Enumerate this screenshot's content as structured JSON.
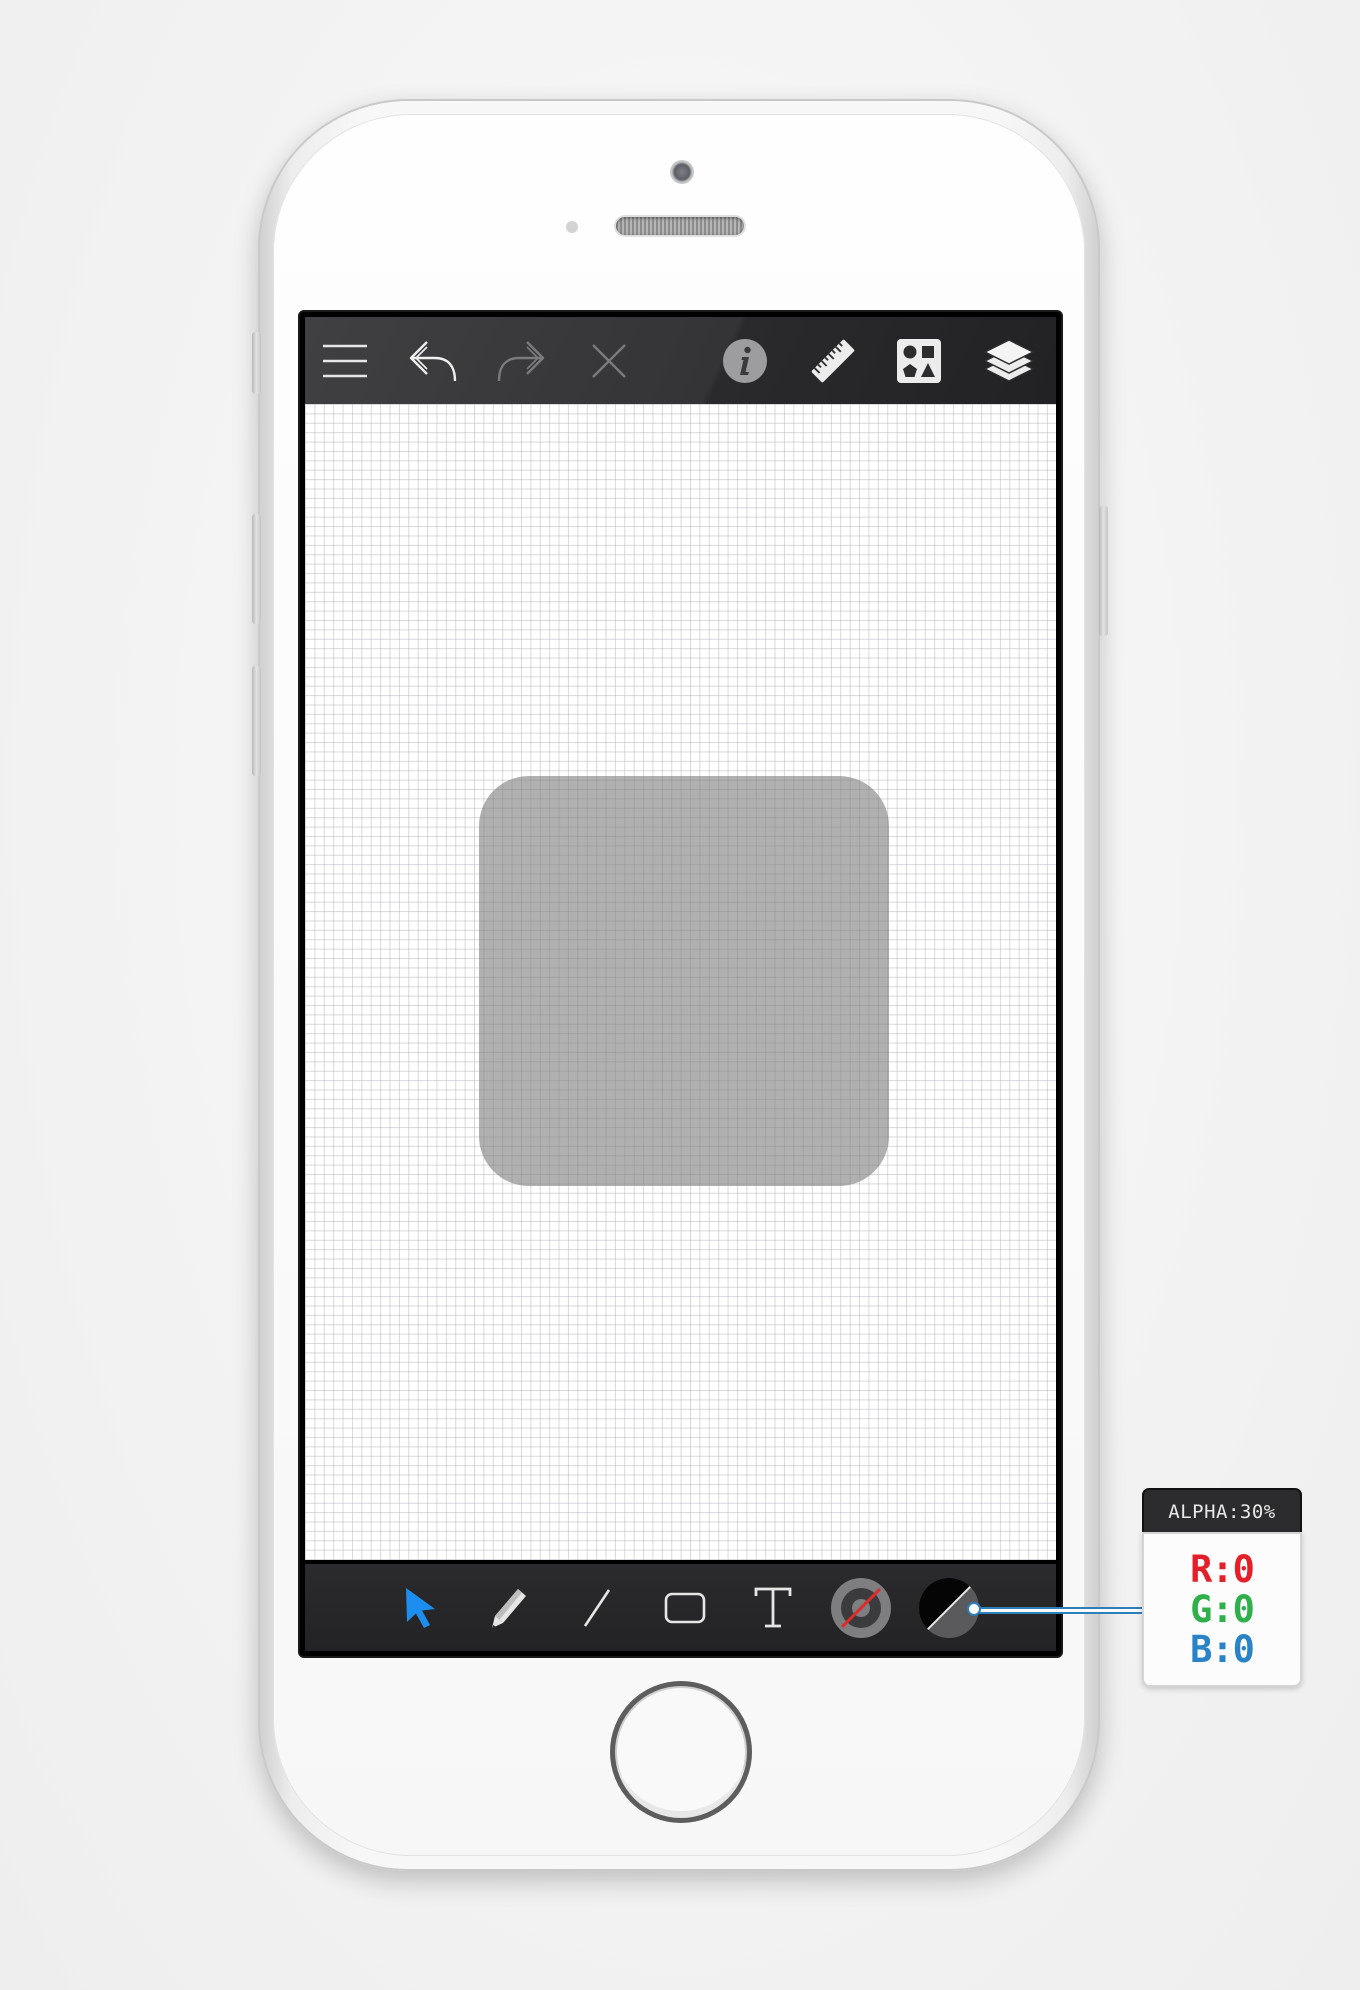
{
  "device": {
    "name": "smartphone",
    "color": "#f7f7f7"
  },
  "toolbar_top": {
    "items": [
      {
        "icon": "menu-icon",
        "enabled": true
      },
      {
        "icon": "undo-icon",
        "enabled": true
      },
      {
        "icon": "redo-icon",
        "enabled": false
      },
      {
        "icon": "close-icon",
        "enabled": false
      },
      {
        "icon": "info-icon",
        "enabled": true
      },
      {
        "icon": "ruler-icon",
        "enabled": true
      },
      {
        "icon": "shapes-library-icon",
        "enabled": true
      },
      {
        "icon": "layers-icon",
        "enabled": true
      }
    ]
  },
  "canvas": {
    "background": "#ffffff",
    "grid": true,
    "grid_color": "#a5a5af",
    "selected_shape": {
      "type": "rounded-rectangle",
      "fill": "#808080",
      "alpha_percent": 30
    }
  },
  "toolbar_bottom": {
    "tools": [
      {
        "icon": "select-arrow-icon",
        "active": true,
        "accent": "#1b8ef0"
      },
      {
        "icon": "pencil-icon",
        "active": false
      },
      {
        "icon": "line-icon",
        "active": false
      },
      {
        "icon": "rectangle-icon",
        "active": false
      },
      {
        "icon": "text-icon",
        "active": false
      },
      {
        "icon": "stroke-color-icon",
        "active": false,
        "accent": "#e02a2a"
      },
      {
        "icon": "fill-color-icon",
        "active": false
      }
    ]
  },
  "color_callout": {
    "alpha_label": "ALPHA:30%",
    "r_label": "R:0",
    "g_label": "G:0",
    "b_label": "B:0",
    "colors": {
      "r": "#e3202a",
      "g": "#2fb04a",
      "b": "#2b83c7",
      "link": "#2d7fba"
    }
  }
}
